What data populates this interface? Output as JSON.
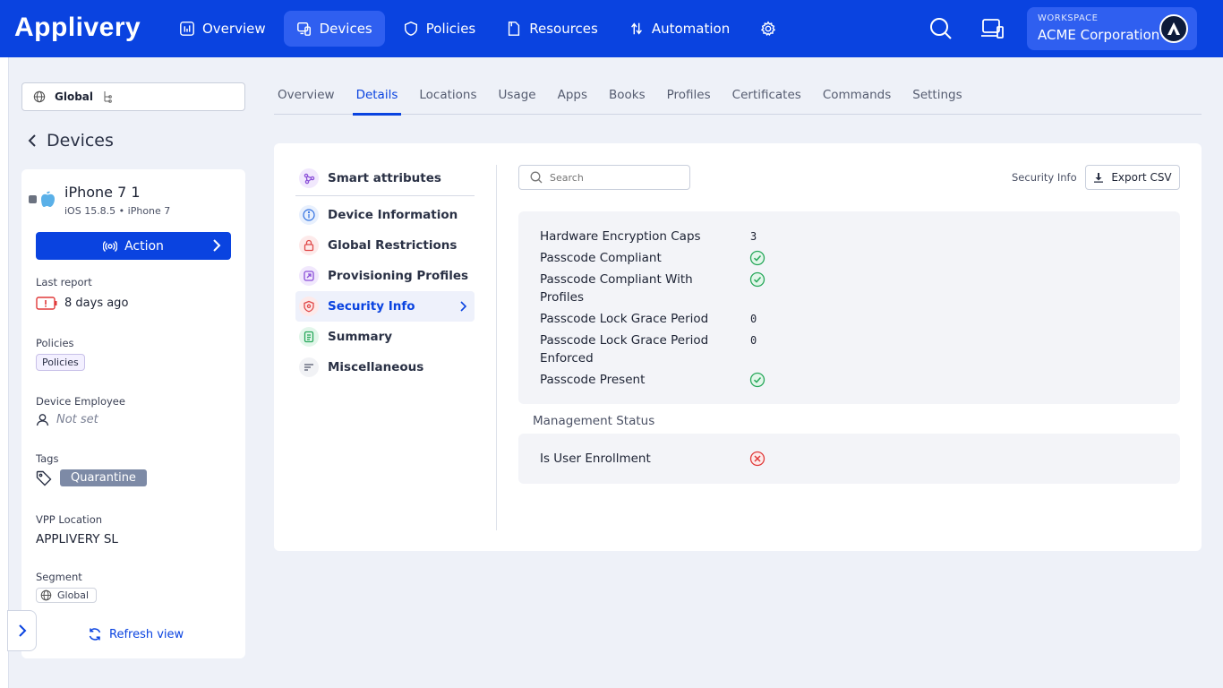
{
  "brand": "Applivery",
  "nav": [
    {
      "label": "Overview",
      "icon": "chart-icon"
    },
    {
      "label": "Devices",
      "icon": "devices-icon",
      "active": true
    },
    {
      "label": "Policies",
      "icon": "shield-icon"
    },
    {
      "label": "Resources",
      "icon": "folder-icon"
    },
    {
      "label": "Automation",
      "icon": "automation-icon"
    }
  ],
  "workspace": {
    "label": "WORKSPACE",
    "name": "ACME Corporation"
  },
  "scope": {
    "label": "Global"
  },
  "back_label": "Devices",
  "device": {
    "name": "iPhone 7 1",
    "subtitle": "iOS 15.8.5 • iPhone 7",
    "action_label": "Action",
    "last_report_label": "Last report",
    "last_report_value": "8 days ago",
    "policies_label": "Policies",
    "policies_chip": "Policies",
    "employee_label": "Device Employee",
    "employee_value": "Not set",
    "tags_label": "Tags",
    "tag": "Quarantine",
    "vpp_label": "VPP Location",
    "vpp_value": "APPLIVERY SL",
    "segment_label": "Segment",
    "segment_value": "Global",
    "refresh_label": "Refresh view"
  },
  "tabs": [
    "Overview",
    "Details",
    "Locations",
    "Usage",
    "Apps",
    "Books",
    "Profiles",
    "Certificates",
    "Commands",
    "Settings"
  ],
  "active_tab": "Details",
  "submenu": [
    {
      "label": "Smart attributes",
      "icon": "smart-icon"
    },
    {
      "label": "Device Information",
      "icon": "info-icon"
    },
    {
      "label": "Global Restrictions",
      "icon": "lock-icon"
    },
    {
      "label": "Provisioning Profiles",
      "icon": "profile-icon"
    },
    {
      "label": "Security Info",
      "icon": "security-icon",
      "active": true
    },
    {
      "label": "Summary",
      "icon": "summary-icon"
    },
    {
      "label": "Miscellaneous",
      "icon": "misc-icon"
    }
  ],
  "search": {
    "placeholder": "Search"
  },
  "section_title": "Security Info",
  "export_label": "Export CSV",
  "security_rows": [
    {
      "key": "Hardware Encryption Caps",
      "value": "3",
      "type": "text"
    },
    {
      "key": "Passcode Compliant",
      "value": "true",
      "type": "check"
    },
    {
      "key": "Passcode Compliant With Profiles",
      "value": "true",
      "type": "check"
    },
    {
      "key": "Passcode Lock Grace Period",
      "value": "0",
      "type": "text"
    },
    {
      "key": "Passcode Lock Grace Period Enforced",
      "value": "0",
      "type": "text"
    },
    {
      "key": "Passcode Present",
      "value": "true",
      "type": "check"
    }
  ],
  "management_title": "Management Status",
  "management_rows": [
    {
      "key": "Is User Enrollment",
      "value": "false",
      "type": "cross"
    }
  ]
}
